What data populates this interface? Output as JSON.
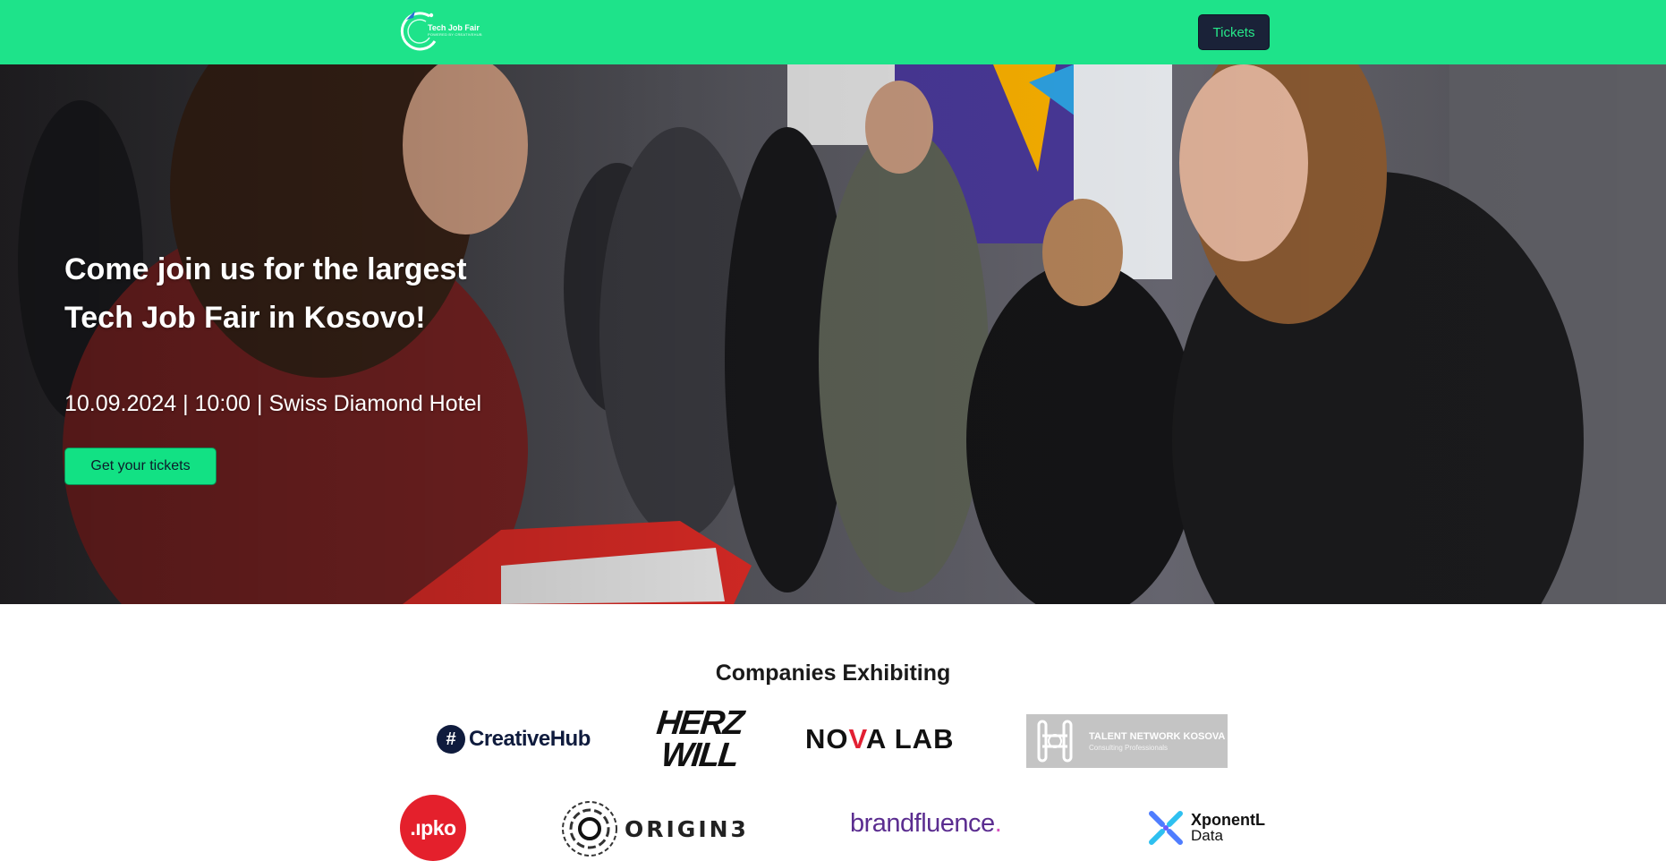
{
  "nav": {
    "logo_title": "Tech Job Fair",
    "logo_subtitle": "POWERED BY CREATIVEHUB",
    "tickets_label": "Tickets"
  },
  "hero": {
    "heading_line1": "Come join us for the largest",
    "heading_line2": "Tech Job Fair in Kosovo!",
    "details": "10.09.2024 | 10:00 | Swiss Diamond Hotel",
    "cta_label": "Get your tickets"
  },
  "companies": {
    "title": "Companies Exhibiting",
    "logos": {
      "creativehub": "CreativeHub",
      "herzwill_line1": "HERZ",
      "herzwill_line2": "WILL",
      "novalab_pre": "NO",
      "novalab_v": "V",
      "novalab_post": "A LAB",
      "talent_main": "TALENT NETWORK KOSOVA",
      "talent_sub": "Consulting Professionals",
      "ipko": ".ıpko",
      "origin3": "ORIGIN3",
      "brandfluence": "brandfluence",
      "brandfluence_dot": ".",
      "xponentl_main": "XponentL",
      "xponentl_sub": "Data"
    }
  },
  "colors": {
    "nav_bg": "#1ee38a",
    "accent_green": "#12e184",
    "dark_navy": "#1a2238",
    "ipko_red": "#e4202c",
    "brandfluence_purple": "#5b2d90"
  }
}
